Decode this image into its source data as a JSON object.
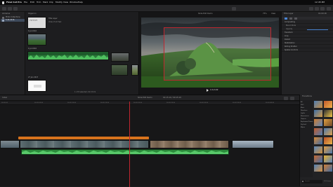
{
  "menubar": {
    "app": "Final Cut Pro",
    "items": [
      "File",
      "Edit",
      "Trim",
      "Mark",
      "Clip",
      "Modify",
      "View",
      "Window",
      "Help"
    ],
    "status": "12:45 PM"
  },
  "libraries": {
    "title": "Libraries",
    "items": [
      {
        "label": "Photo Collections"
      },
      {
        "label": "5-24-2016"
      }
    ]
  },
  "browser": {
    "group_title": "Kilgarron",
    "sections": [
      {
        "label": "6 Jul 2016"
      },
      {
        "label": "6 Jul 2016"
      },
      {
        "label": "27 Jan 2017"
      }
    ],
    "clips": [
      {
        "label": "Title Layer"
      },
      {
        "label": "Video Hold Test"
      },
      {
        "label": ""
      },
      {
        "label": ""
      }
    ],
    "footer": "1 of 8 selected, 01:15:19"
  },
  "viewer": {
    "title": "Slide Edit Demo",
    "zoom": "75%",
    "view_menu": "View",
    "timecode": "1:12:22",
    "play_icon": "play-icon"
  },
  "inspector": {
    "title": "Title Layer",
    "timecode": "01:00:18",
    "sections": [
      "Compositing",
      "Blend Mode",
      "Opacity",
      "Transform",
      "Crop",
      "Distort",
      "Stabilization",
      "Rolling Shutter",
      "Spatial Conform"
    ]
  },
  "timeline": {
    "index_label": "Index",
    "project_title": "Slide Edit Demo",
    "duration": "01:15:19 / 09:15:19",
    "ruler_marks": [
      "00:00:00",
      "00:00:05:00",
      "00:00:10:00",
      "00:00:15:00",
      "00:00:20:00",
      "00:00:25:00",
      "00:00:30:00",
      "00:00:35:00",
      "00:00:40:00"
    ]
  },
  "effects": {
    "title": "Transitions",
    "search_placeholder": "Search",
    "categories": [
      "All",
      "360°",
      "Blurs",
      "Dissolves",
      "Lights",
      "Movements",
      "Objects",
      "Replicator/Clones",
      "Stylized",
      "Wipes"
    ],
    "count": "101 items"
  },
  "colors": {
    "accent": "#e8b233",
    "timeline_title": "#d8731d",
    "audio": "#2c8a3c",
    "selection": "#c0262f"
  }
}
